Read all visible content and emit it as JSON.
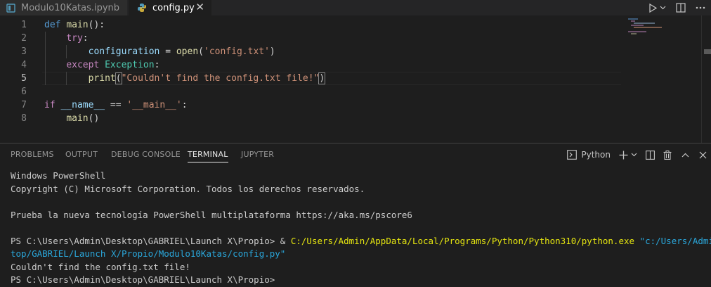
{
  "tabs": [
    {
      "label": "Modulo10Katas.ipynb",
      "active": false
    },
    {
      "label": "config.py",
      "active": true
    }
  ],
  "editor": {
    "line_numbers": [
      "1",
      "2",
      "3",
      "4",
      "5",
      "6",
      "7",
      "8"
    ],
    "lines": [
      {
        "tokens": [
          {
            "t": "def",
            "c": "kw"
          },
          {
            "t": " "
          },
          {
            "t": "main",
            "c": "fn"
          },
          {
            "t": "():"
          }
        ]
      },
      {
        "tokens": [
          {
            "t": "    "
          },
          {
            "t": "try",
            "c": "ctl"
          },
          {
            "t": ":"
          }
        ]
      },
      {
        "tokens": [
          {
            "t": "        "
          },
          {
            "t": "configuration",
            "c": "var"
          },
          {
            "t": " = "
          },
          {
            "t": "open",
            "c": "fn"
          },
          {
            "t": "("
          },
          {
            "t": "'config.txt'",
            "c": "str"
          },
          {
            "t": ")"
          }
        ]
      },
      {
        "tokens": [
          {
            "t": "    "
          },
          {
            "t": "except",
            "c": "ctl"
          },
          {
            "t": " "
          },
          {
            "t": "Exception",
            "c": "cls"
          },
          {
            "t": ":"
          }
        ]
      },
      {
        "tokens": [
          {
            "t": "        "
          },
          {
            "t": "print",
            "c": "fn"
          },
          {
            "t": "(",
            "c": "brk"
          },
          {
            "t": "\"Couldn't find the config.txt file!\"",
            "c": "str"
          },
          {
            "t": ")",
            "c": "brk"
          }
        ]
      },
      {
        "tokens": []
      },
      {
        "tokens": [
          {
            "t": "if",
            "c": "ctl"
          },
          {
            "t": " "
          },
          {
            "t": "__name__",
            "c": "var"
          },
          {
            "t": " == "
          },
          {
            "t": "'__main__'",
            "c": "str"
          },
          {
            "t": ":"
          }
        ]
      },
      {
        "tokens": [
          {
            "t": "    "
          },
          {
            "t": "main",
            "c": "fn"
          },
          {
            "t": "()"
          }
        ]
      }
    ]
  },
  "panel": {
    "tabs": [
      "PROBLEMS",
      "OUTPUT",
      "DEBUG CONSOLE",
      "TERMINAL",
      "JUPYTER"
    ],
    "active_tab": "TERMINAL",
    "terminal_profile": "Python"
  },
  "terminal": {
    "lines": [
      [
        {
          "t": "Windows PowerShell"
        }
      ],
      [
        {
          "t": "Copyright (C) Microsoft Corporation. Todos los derechos reservados."
        }
      ],
      [],
      [
        {
          "t": "Prueba la nueva tecnología PowerShell multiplataforma https://aka.ms/pscore6"
        }
      ],
      [],
      [
        {
          "t": "PS C:\\Users\\Admin\\Desktop\\GABRIEL\\Launch X\\Propio> & "
        },
        {
          "t": "C:/Users/Admin/AppData/Local/Programs/Python/Python310/python.exe",
          "c": "tyellow"
        },
        {
          "t": " \"c:/Users/Admin/Desk",
          "c": "tcyan"
        }
      ],
      [
        {
          "t": "top/GABRIEL/Launch X/Propio/Modulo10Katas/config.py\"",
          "c": "tcyan"
        }
      ],
      [
        {
          "t": "Couldn't find the config.txt file!"
        }
      ],
      [
        {
          "t": "PS C:\\Users\\Admin\\Desktop\\GABRIEL\\Launch X\\Propio>"
        }
      ]
    ]
  },
  "colors": {
    "background": "#1e1e1e",
    "accent": "#007acc",
    "keyword": "#569cd6",
    "control": "#c586c0",
    "function": "#dcdcaa",
    "string": "#ce9178",
    "class": "#4ec9b0"
  }
}
